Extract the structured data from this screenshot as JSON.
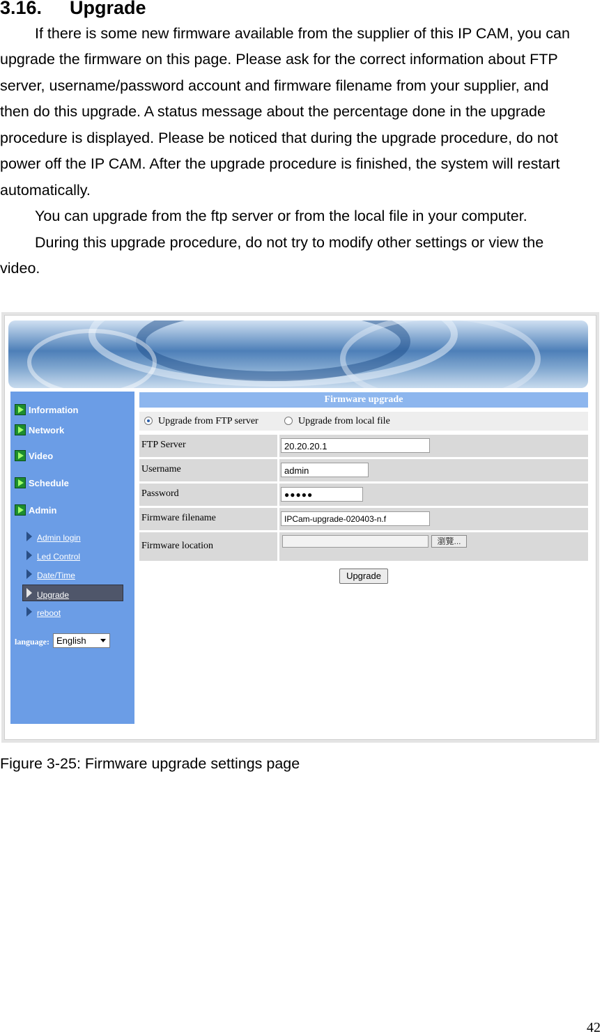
{
  "section": {
    "number": "3.16.",
    "title": "Upgrade"
  },
  "paragraphs": [
    "If there is some new firmware available from the supplier of this IP CAM, you can",
    "upgrade the firmware on this page. Please ask for the correct information about FTP",
    "server, username/password account and firmware filename from your supplier, and",
    "then do this upgrade. A status message about the percentage done in the upgrade",
    "procedure is displayed. Please be noticed that during the upgrade procedure, do not",
    "power off the IP CAM. After the upgrade procedure is finished, the system will restart",
    "automatically.",
    "You can upgrade from the ftp server or from the local file in your computer.",
    "During this upgrade procedure, do not try to modify other settings or view the",
    "video."
  ],
  "screenshot": {
    "sidebar": {
      "items": [
        "Information",
        "Network",
        "Video",
        "Schedule",
        "Admin"
      ],
      "admin_subitems": [
        "Admin login",
        "Led Control",
        "Date/Time",
        "Upgrade",
        "reboot"
      ],
      "active_subitem": "Upgrade",
      "language_label": "language:",
      "language_value": "English"
    },
    "panel": {
      "title": "Firmware upgrade",
      "radio_ftp": "Upgrade from FTP server",
      "radio_local": "Upgrade from local file",
      "selected_radio": "ftp",
      "ftp_server_label": "FTP Server",
      "ftp_server_value": "20.20.20.1",
      "username_label": "Username",
      "username_value": "admin",
      "password_label": "Password",
      "password_value": "●●●●●",
      "filename_label": "Firmware filename",
      "filename_value": "IPCam-upgrade-020403-n.f",
      "location_label": "Firmware location",
      "location_value": "",
      "browse_label": "瀏覽...",
      "upgrade_button": "Upgrade"
    }
  },
  "caption": "Figure 3-25: Firmware upgrade settings page",
  "page_number": "42",
  "colors": {
    "sidebar": "#6b9de6",
    "title_bar": "#8db6ee",
    "cell": "#d9d9d9",
    "active_item": "#4f566a"
  }
}
